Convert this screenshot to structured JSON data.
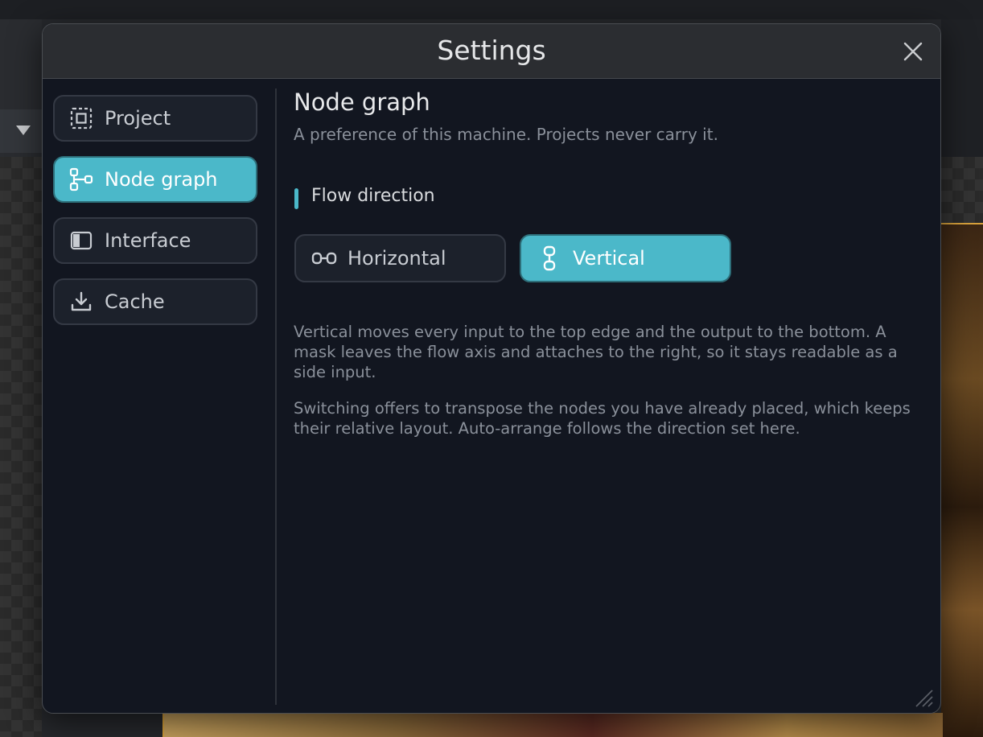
{
  "dialog": {
    "title": "Settings",
    "close_icon": "close-icon"
  },
  "sidebar": {
    "items": [
      {
        "label": "Project",
        "icon": "project-frame-icon",
        "active": false
      },
      {
        "label": "Node graph",
        "icon": "node-graph-icon",
        "active": true
      },
      {
        "label": "Interface",
        "icon": "interface-panel-icon",
        "active": false
      },
      {
        "label": "Cache",
        "icon": "download-icon",
        "active": false
      }
    ]
  },
  "content": {
    "title": "Node graph",
    "subtitle": "A preference of this machine. Projects never carry it.",
    "section": {
      "title": "Flow direction",
      "options": [
        {
          "label": "Horizontal",
          "icon": "horizontal-flow-icon",
          "selected": false
        },
        {
          "label": "Vertical",
          "icon": "vertical-flow-icon",
          "selected": true
        }
      ]
    },
    "paragraphs": [
      "Vertical moves every input to the top edge and the output to the bottom. A mask leaves the flow axis and attaches to the right, so it stays readable as a side input.",
      "Switching offers to transpose the nodes you have already placed, which keeps their relative layout. Auto-arrange follows the direction set here."
    ]
  },
  "colors": {
    "accent": "#4bb8c9",
    "dialog_background": "#121620",
    "header_background": "#2b2d31"
  }
}
